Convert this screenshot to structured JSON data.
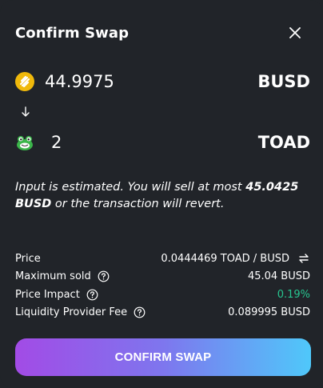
{
  "title": "Confirm Swap",
  "input_token": {
    "amount": "44.9975",
    "symbol": "BUSD",
    "icon": "busd-coin-icon",
    "color": "#F0B90B"
  },
  "output_token": {
    "amount": "2",
    "symbol": "TOAD",
    "icon": "toad-frog-icon",
    "color": "#3BB54A"
  },
  "notice": {
    "prefix": "Input is estimated. You will sell at most ",
    "amount": "45.0425 BUSD",
    "suffix": " or the transaction will revert."
  },
  "details": {
    "price_label": "Price",
    "price_value": "0.0444469 TOAD / BUSD",
    "max_sold_label": "Maximum sold",
    "max_sold_value": "45.04 BUSD",
    "price_impact_label": "Price Impact",
    "price_impact_value": "0.19%",
    "lp_fee_label": "Liquidity Provider Fee",
    "lp_fee_value": "0.089995 BUSD"
  },
  "confirm_label": "CONFIRM SWAP",
  "colors": {
    "background": "#212429",
    "accent_green": "#27C690",
    "button_gradient_start": "#A24BE6",
    "button_gradient_end": "#4FC8FA"
  }
}
